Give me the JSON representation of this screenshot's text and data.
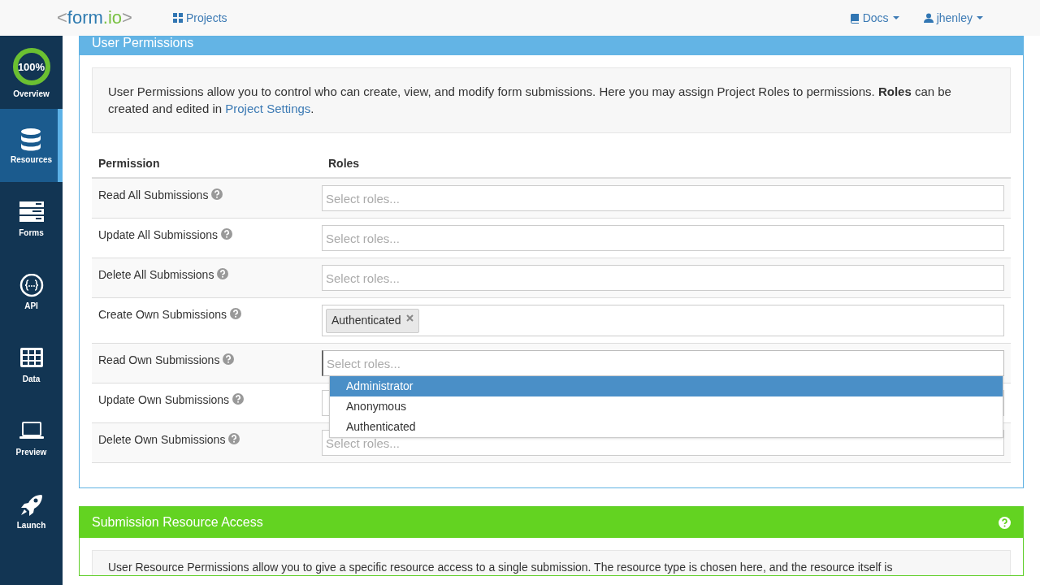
{
  "header": {
    "logo": {
      "open": "<",
      "name": "form",
      "suffix": ".io",
      "close": ">"
    },
    "nav": [
      {
        "kind": "grid",
        "label": "Projects"
      }
    ],
    "right": [
      {
        "kind": "book",
        "label": "Docs"
      },
      {
        "kind": "user",
        "label": "jhenley"
      }
    ]
  },
  "sidebar": {
    "items": [
      {
        "kind": "progress",
        "label": "Overview",
        "badge": "100%",
        "level": 1.0,
        "selected": false
      },
      {
        "kind": "database",
        "label": "Resources",
        "selected": true
      },
      {
        "kind": "forms",
        "label": "Forms",
        "selected": false
      },
      {
        "kind": "api",
        "label": "API",
        "selected": false
      },
      {
        "kind": "data",
        "label": "Data",
        "selected": false
      },
      {
        "kind": "preview",
        "label": "Preview",
        "selected": false
      },
      {
        "kind": "launch",
        "label": "Launch",
        "selected": false
      }
    ]
  },
  "permissions_panel": {
    "title": "User Permissions",
    "description": "User Permissions allow you to control who can create, view, and modify form submissions. Here you may assign Project Roles to permissions. **Roles** can be created and edited in ",
    "link": "Project Settings",
    "description_end": ".",
    "columns": [
      "Permission",
      "Roles"
    ],
    "rows": [
      {
        "name": "Read All Submissions",
        "placeholder": "Select roles..."
      },
      {
        "name": "Update All Submissions",
        "placeholder": "Select roles..."
      },
      {
        "name": "Delete All Submissions",
        "placeholder": "Select roles..."
      },
      {
        "name": "Create Own Submissions",
        "tags": [
          "Authenticated"
        ]
      },
      {
        "name": "Read Own Submissions",
        "placeholder": "Select roles...",
        "focused": true,
        "dropdown": [
          {
            "label": "Administrator",
            "selected": true
          },
          {
            "label": "Anonymous",
            "selected": false
          },
          {
            "label": "Authenticated",
            "selected": false
          }
        ]
      },
      {
        "name": "Update Own Submissions"
      },
      {
        "name": "Delete Own Submissions",
        "placeholder": "Select roles..."
      }
    ]
  },
  "resource_panel": {
    "title": "Submission Resource Access",
    "description": "User Resource Permissions allow you to give a specific resource access to a single submission. The resource type is chosen here, and the resource itself is"
  }
}
